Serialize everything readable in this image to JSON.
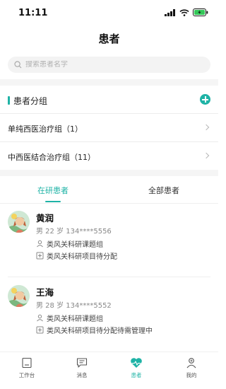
{
  "status_bar": {
    "time": "11:11"
  },
  "nav": {
    "title": "患者"
  },
  "search": {
    "placeholder": "搜索患者名字"
  },
  "groups": {
    "title": "患者分组",
    "items": [
      {
        "label": "单纯西医治疗组（1）"
      },
      {
        "label": "中西医结合治疗组（11）"
      }
    ]
  },
  "tabs": {
    "active_label": "在研患者",
    "all_label": "全部患者"
  },
  "patients": [
    {
      "name": "黄润",
      "meta": "男 22 岁 134****5556",
      "group": "类风关科研课题组",
      "status": "类风关科研项目待分配"
    },
    {
      "name": "王海",
      "meta": "男 28 岁 134****5552",
      "group": "类风关科研课题组",
      "status": "类风关科研项目待分配待需管理中"
    }
  ],
  "tab_bar": [
    {
      "label": "工作台",
      "icon": "workbench-icon"
    },
    {
      "label": "消息",
      "icon": "message-icon"
    },
    {
      "label": "患者",
      "icon": "patient-heart-icon"
    },
    {
      "label": "我的",
      "icon": "profile-icon"
    }
  ],
  "colors": {
    "accent": "#1fb3a6",
    "background_band": "#f5f5f5"
  }
}
